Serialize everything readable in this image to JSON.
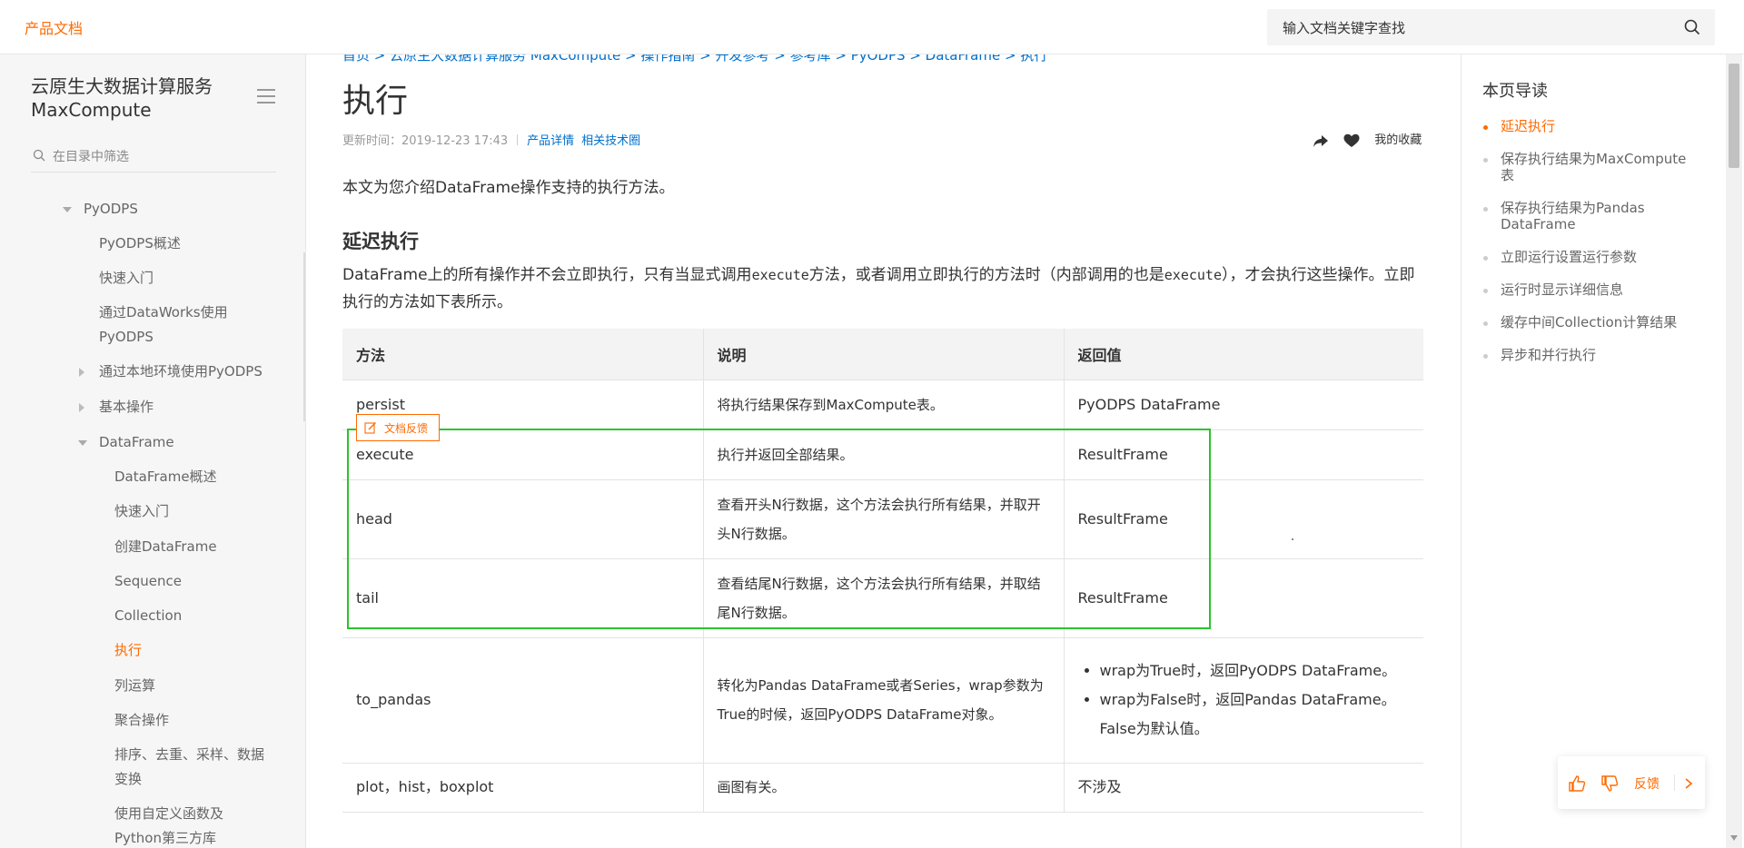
{
  "header": {
    "brand": "产品文档",
    "search_placeholder": "输入文档关键字查找"
  },
  "sidebar": {
    "title": "云原生大数据计算服务 MaxCompute",
    "filter_placeholder": "在目录中筛选",
    "items": [
      {
        "label": "PyODPS"
      },
      {
        "label": "PyODPS概述"
      },
      {
        "label": "快速入门"
      },
      {
        "label": "通过DataWorks使用"
      },
      {
        "label": "PyODPS"
      },
      {
        "label": "通过本地环境使用PyODPS"
      },
      {
        "label": "基本操作"
      },
      {
        "label": "DataFrame"
      },
      {
        "label": "DataFrame概述"
      },
      {
        "label": "快速入门"
      },
      {
        "label": "创建DataFrame"
      },
      {
        "label": "Sequence"
      },
      {
        "label": "Collection"
      },
      {
        "label": "执行"
      },
      {
        "label": "列运算"
      },
      {
        "label": "聚合操作"
      },
      {
        "label": "排序、去重、采样、数据"
      },
      {
        "label": "变换"
      },
      {
        "label": "使用自定义函数及"
      },
      {
        "label": "Python第三方库"
      }
    ]
  },
  "main": {
    "breadcrumb": "首页 > 云原生大数据计算服务 MaxCompute > 操作指南 > 开发参考 > 参考库 > PyODPS > DataFrame > 执行",
    "title": "执行",
    "updated": "更新时间：2019-12-23 17:43",
    "link_product": "产品详情",
    "link_circle": "相关技术圈",
    "favorite_label": "我的收藏",
    "intro": "本文为您介绍DataFrame操作支持的执行方法。",
    "section_title": "延迟执行",
    "para_1": "DataFrame上的所有操作并不会立即执行，只有当显式调用",
    "para_code_1": "execute",
    "para_2": "方法，或者调用立即执行的方法时（内部调用的也是",
    "para_code_2": "execute",
    "para_3": "），才会执行这些操作。立即执行的方法如下表所示。",
    "feedback_tag": "文档反馈",
    "table": {
      "headers": [
        "方法",
        "说明",
        "返回值"
      ],
      "rows": [
        {
          "method": "persist",
          "desc": "将执行结果保存到MaxCompute表。",
          "ret": "PyODPS DataFrame"
        },
        {
          "method": "execute",
          "desc": "执行并返回全部结果。",
          "ret": "ResultFrame"
        },
        {
          "method": "head",
          "desc": "查看开头N行数据，这个方法会执行所有结果，并取开头N行数据。",
          "ret": "ResultFrame"
        },
        {
          "method": "tail",
          "desc": "查看结尾N行数据，这个方法会执行所有结果，并取结尾N行数据。",
          "ret": "ResultFrame"
        },
        {
          "method": "to_pandas",
          "desc": "转化为Pandas DataFrame或者Series，wrap参数为True的时候，返回PyODPS DataFrame对象。",
          "ret_list": [
            "wrap为True时，返回PyODPS DataFrame。",
            "wrap为False时，返回Pandas DataFrame。False为默认值。"
          ]
        },
        {
          "method": "plot，hist，boxplot",
          "desc": "画图有关。",
          "ret": "不涉及"
        }
      ]
    }
  },
  "toc": {
    "title": "本页导读",
    "items": [
      "延迟执行",
      "保存执行结果为MaxCompute表",
      "保存执行结果为Pandas DataFrame",
      "立即运行设置运行参数",
      "运行时显示详细信息",
      "缓存中间Collection计算结果",
      "异步和并行执行"
    ]
  },
  "feedback": {
    "label": "反馈"
  },
  "colors": {
    "accent": "#ff6a00",
    "link": "#0070cc",
    "highlight": "#2bc42b"
  }
}
